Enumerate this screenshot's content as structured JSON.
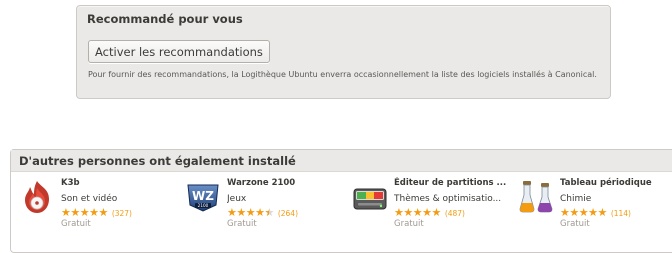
{
  "recommended": {
    "title": "Recommandé pour vous",
    "button_label": "Activer les recommandations",
    "description": "Pour fournir des recommandations, la Logithèque Ubuntu enverra occasionnellement la liste des logiciels installés à Canonical."
  },
  "also_installed": {
    "title": "D'autres personnes ont également installé",
    "apps": [
      {
        "name": "K3b",
        "category": "Son et vidéo",
        "rating": 5,
        "reviews": "(327)",
        "price": "Gratuit",
        "icon": "k3b-icon"
      },
      {
        "name": "Warzone 2100",
        "category": "Jeux",
        "rating": 4.5,
        "reviews": "(264)",
        "price": "Gratuit",
        "icon": "warzone-icon"
      },
      {
        "name": "Éditeur de partitions ...",
        "category": "Thèmes & optimisatio...",
        "rating": 5,
        "reviews": "(487)",
        "price": "Gratuit",
        "icon": "disk-icon"
      },
      {
        "name": "Tableau périodique",
        "category": "Chimie",
        "rating": 5,
        "reviews": "(114)",
        "price": "Gratuit",
        "icon": "flask-icon"
      }
    ]
  },
  "colors": {
    "star": "#f39c12",
    "panel_bg": "#ebe9e7",
    "text": "#3c3b37",
    "muted": "#a09a92"
  }
}
